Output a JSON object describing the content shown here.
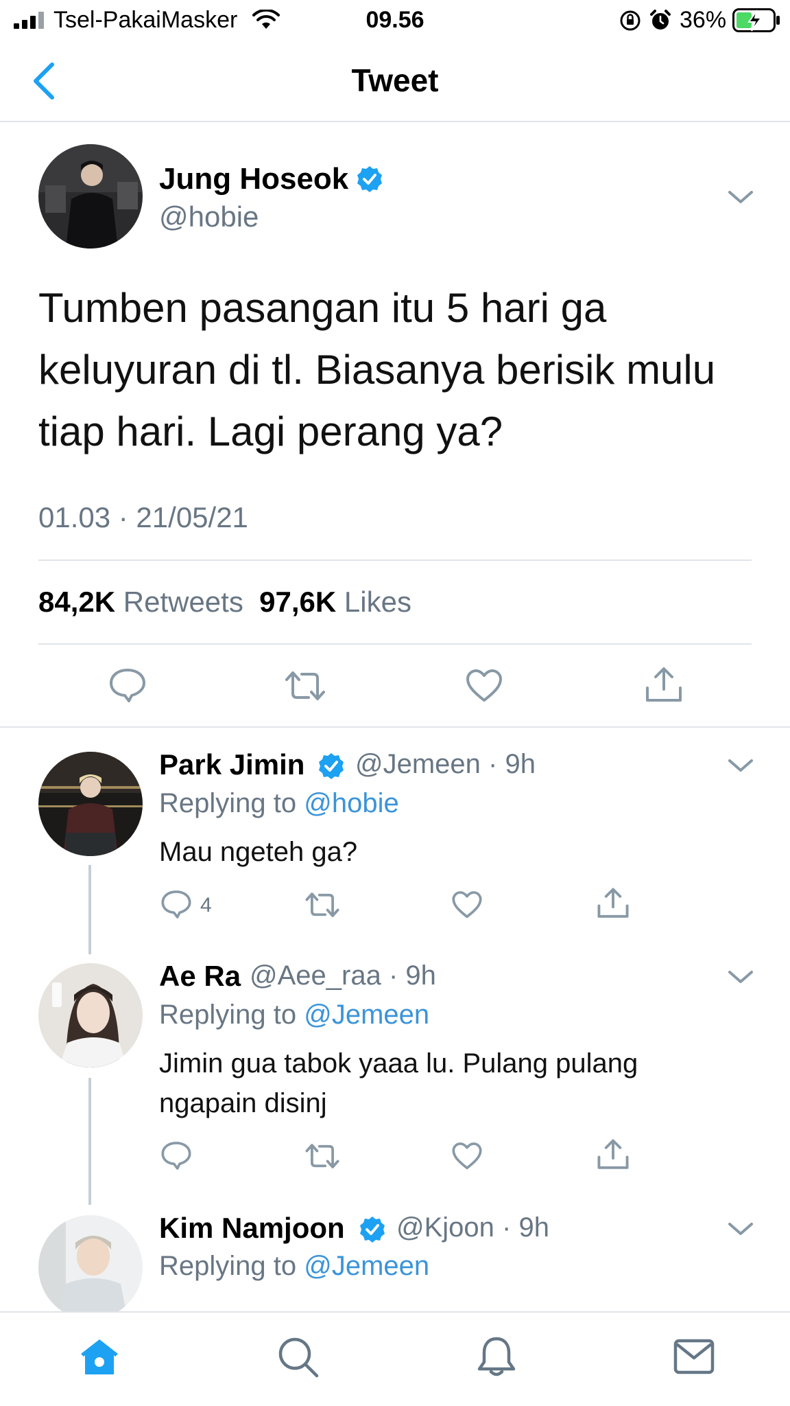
{
  "status_bar": {
    "carrier": "Tsel-PakaiMasker",
    "time": "09.56",
    "battery": "36%"
  },
  "nav": {
    "title": "Tweet",
    "back_icon": "chevron-left-icon"
  },
  "tweet": {
    "author_name": "Jung Hoseok",
    "author_handle": "@hobie",
    "text_lines": [
      "Tumben pasangan itu 5 hari ga",
      "keluyuran di tl. Biasanya berisik mulu",
      "tiap hari. Lagi perang ya?"
    ],
    "timestamp": "01.03 · 21/05/21",
    "retweets_count": "84,2K",
    "retweets_label": "Retweets",
    "likes_count": "97,6K",
    "likes_label": "Likes"
  },
  "replies": [
    {
      "name": "Park Jimin",
      "verified": true,
      "handle": "@Jemeen · 9h",
      "replying_prefix": "Replying to",
      "replying_to": "@hobie",
      "text_lines": [
        "Mau ngeteh ga?"
      ],
      "reply_count": "4"
    },
    {
      "name": "Ae Ra",
      "verified": false,
      "handle": "@Aee_raa · 9h",
      "replying_prefix": "Replying to",
      "replying_to": "@Jemeen",
      "text_lines": [
        "Jimin gua tabok yaaa lu. Pulang pulang",
        "ngapain disinj"
      ],
      "reply_count": ""
    },
    {
      "name": "Kim Namjoon",
      "verified": true,
      "handle": "@Kjoon · 9h",
      "replying_prefix": "Replying to",
      "replying_to": "@Jemeen",
      "text_lines": [],
      "reply_count": ""
    }
  ],
  "colors": {
    "accent": "#1da1f2",
    "link": "#3b94d9",
    "secondary_text": "#687684",
    "divider": "#e1e4e8"
  },
  "tab_bar": [
    "home-icon",
    "search-icon",
    "notifications-icon",
    "messages-icon"
  ]
}
